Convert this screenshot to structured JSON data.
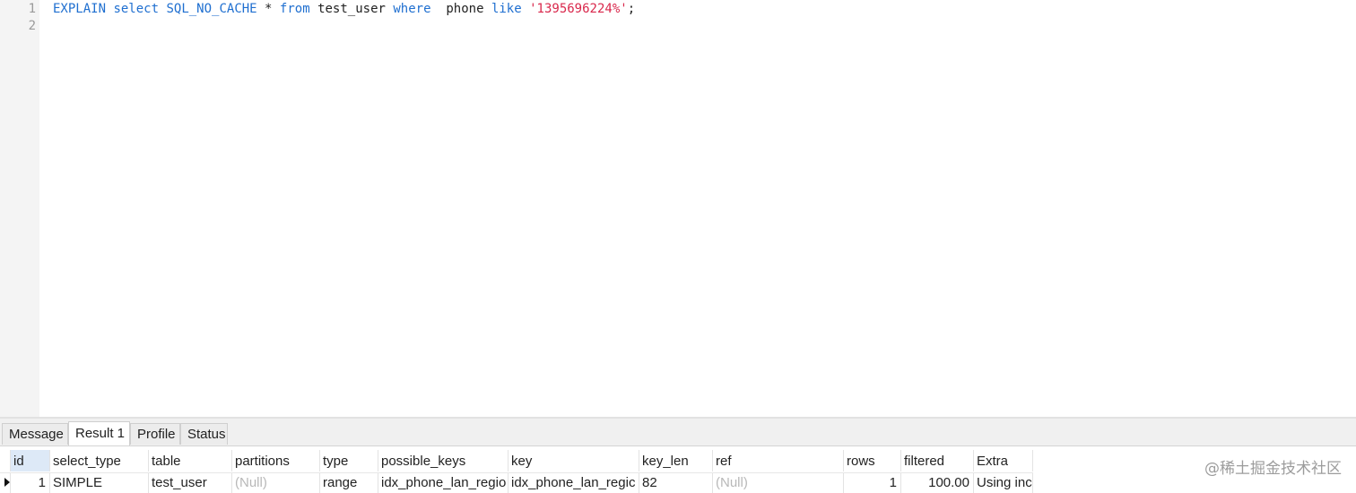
{
  "editor": {
    "line_numbers": [
      "1",
      "2"
    ],
    "line1": {
      "t1": "EXPLAIN",
      "t2": " ",
      "t3": "select",
      "t4": " ",
      "t5": "SQL_NO_CACHE",
      "t6": " * ",
      "t7": "from",
      "t8": " test_user ",
      "t9": "where",
      "t10": "  phone ",
      "t11": "like",
      "t12": " ",
      "t13": "'1395696224%'",
      "t14": ";"
    }
  },
  "tabs": [
    {
      "label": "Message"
    },
    {
      "label": "Result 1"
    },
    {
      "label": "Profile"
    },
    {
      "label": "Status"
    }
  ],
  "grid": {
    "columns": [
      "id",
      "select_type",
      "table",
      "partitions",
      "type",
      "possible_keys",
      "key",
      "key_len",
      "ref",
      "rows",
      "filtered",
      "Extra"
    ],
    "rows": [
      [
        "1",
        "SIMPLE",
        "test_user",
        "(Null)",
        "range",
        "idx_phone_lan_regio",
        "idx_phone_lan_regic",
        "82",
        "(Null)",
        "1",
        "100.00",
        "Using inc"
      ]
    ]
  },
  "watermark": "@稀土掘金技术社区",
  "colors": {
    "keyword": "#1f6fd0",
    "string": "#d9284c",
    "null_text": "#b8b8b8",
    "selected_header": "#dde9f7"
  }
}
